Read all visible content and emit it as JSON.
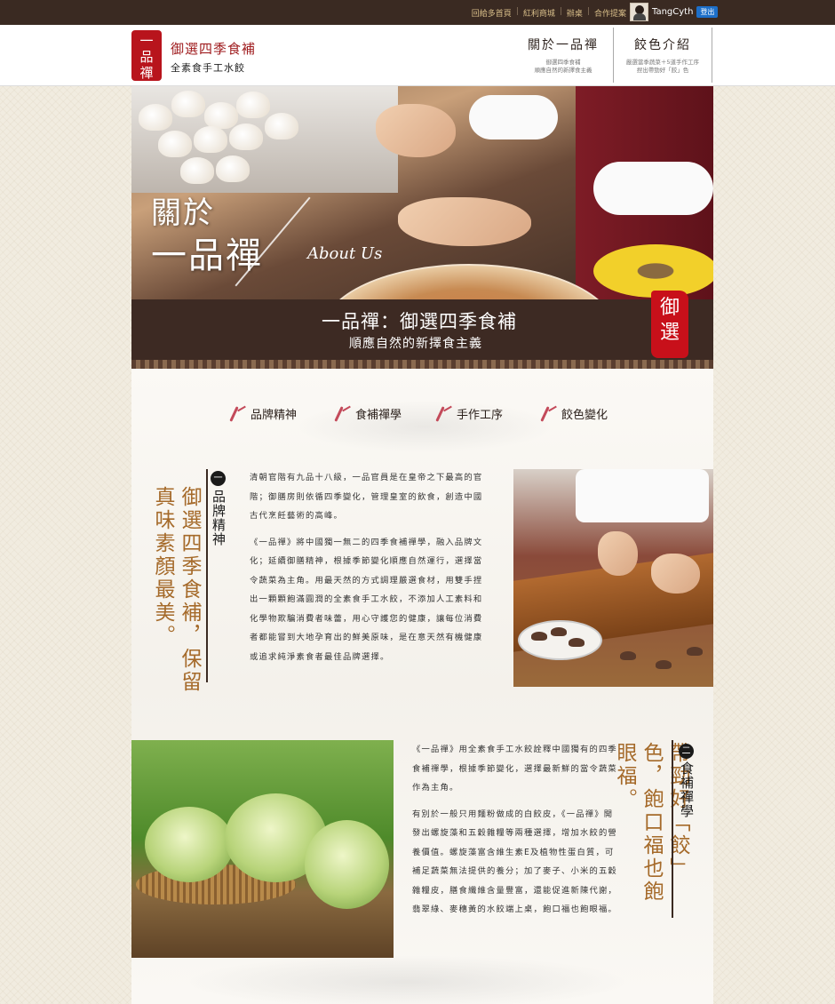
{
  "topbar": {
    "links": [
      "回給多首頁",
      "紅利商城",
      "辦桌",
      "合作提案"
    ],
    "user_name": "TangCyth",
    "logout_label": "登出"
  },
  "header": {
    "logo_text": "一品禪",
    "brand_line1": "御選四季食補",
    "brand_line2": "全素食手工水餃",
    "nav": [
      {
        "title": "關於一品禪",
        "sub1": "御選四季食補",
        "sub2": "順應自然的新擇食主義"
      },
      {
        "title": "餃色介紹",
        "sub1": "嚴選當季蔬菜＋5道手作工序",
        "sub2": "捏出帶勁好「餃」色"
      }
    ]
  },
  "hero": {
    "title_line1": "關於",
    "title_line2": "一品禪",
    "about": "About Us"
  },
  "banner": {
    "line1": "一品禪：御選四季食補",
    "line2": "順應自然的新擇食主義",
    "seal": "御選"
  },
  "tabs": [
    "品牌精神",
    "食補禪學",
    "手作工序",
    "餃色變化"
  ],
  "section1": {
    "num": "一",
    "label": "品牌精神",
    "headline": "御選四季食補，保留真味素顏最美。",
    "para1": "清朝官階有九品十八級，一品官員是在皇帝之下最高的官階；御膳房則依循四季變化，管理皇室的飲食，創造中國古代烹飪藝術的高峰。",
    "para2": "《一品禪》將中國獨一無二的四季食補禪學，融入品牌文化；延續御膳精神，根據季節變化順應自然運行，選擇當令蔬菜為主角。用最天然的方式調理嚴選食材，用雙手捏出一顆顆飽滿圓潤的全素食手工水餃，不添加人工素料和化學物欺騙消費者味蕾，用心守護您的健康，讓每位消費者都能嘗到大地孕育出的鮮美原味，是在意天然有機健康或追求純淨素食者最佳品牌選擇。"
  },
  "section2": {
    "num": "二",
    "label": "食補禪學",
    "headline": "帶勁好「餃」色，飽口福也飽眼福。",
    "para1": "《一品禪》用全素食手工水餃詮釋中國獨有的四季食補禪學，根據季節變化，選擇最新鮮的當令蔬菜作為主角。",
    "para2": "有別於一般只用麵粉做成的白餃皮，《一品禪》開發出螺旋藻和五穀雜糧等兩種選擇，增加水餃的營養價值。螺旋藻富含維生素E及植物性蛋白質，可補足蔬菜無法提供的養分；加了麥子、小米的五穀雜糧皮，膳食纖維含量豐富，還能促進新陳代謝，翡翠綠、麥穗黃的水餃端上桌，飽口福也飽眼福。"
  }
}
